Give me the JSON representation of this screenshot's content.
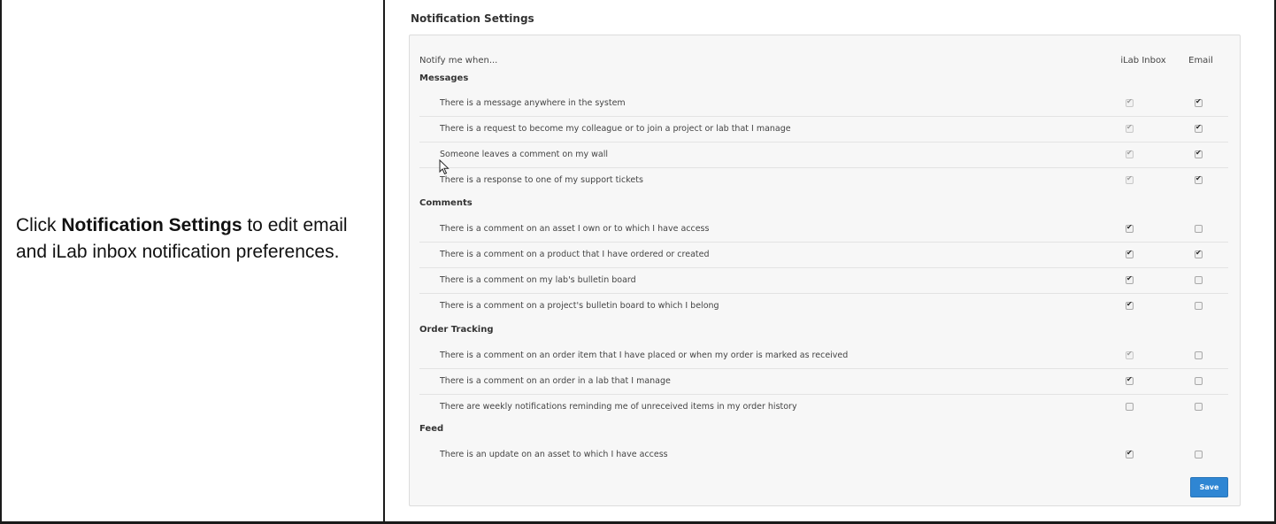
{
  "instruction": {
    "prefix": "Click ",
    "bold": "Notification Settings",
    "suffix": " to edit email and iLab inbox notification preferences."
  },
  "settings_title": "Notification Settings",
  "headers": {
    "notify": "Notify me when...",
    "inbox": "iLab Inbox",
    "email": "Email"
  },
  "sections": [
    {
      "title": "Messages",
      "rows": [
        {
          "label": "There is a message anywhere in the system",
          "inbox": true,
          "inbox_disabled": true,
          "email": true
        },
        {
          "label": "There is a request to become my colleague or to join a project or lab that I manage",
          "inbox": true,
          "inbox_disabled": true,
          "email": true
        },
        {
          "label": "Someone leaves a comment on my wall",
          "inbox": true,
          "inbox_disabled": true,
          "email": true
        },
        {
          "label": "There is a response to one of my support tickets",
          "inbox": true,
          "inbox_disabled": true,
          "email": true
        }
      ]
    },
    {
      "title": "Comments",
      "rows": [
        {
          "label": "There is a comment on an asset I own or to which I have access",
          "inbox": true,
          "inbox_disabled": false,
          "email": false
        },
        {
          "label": "There is a comment on a product that I have ordered or created",
          "inbox": true,
          "inbox_disabled": false,
          "email": true
        },
        {
          "label": "There is a comment on my lab's bulletin board",
          "inbox": true,
          "inbox_disabled": false,
          "email": false
        },
        {
          "label": "There is a comment on a project's bulletin board to which I belong",
          "inbox": true,
          "inbox_disabled": false,
          "email": false
        }
      ]
    },
    {
      "title": "Order Tracking",
      "rows": [
        {
          "label": "There is a comment on an order item that I have placed or when my order is marked as received",
          "inbox": true,
          "inbox_disabled": true,
          "email": false
        },
        {
          "label": "There is a comment on an order in a lab that I manage",
          "inbox": true,
          "inbox_disabled": false,
          "email": false
        },
        {
          "label": "There are weekly notifications reminding me of unreceived items in my order history",
          "inbox": false,
          "inbox_disabled": false,
          "email": false
        }
      ]
    },
    {
      "title": "Feed",
      "rows": [
        {
          "label": "There is an update on an asset to which I have access",
          "inbox": true,
          "inbox_disabled": false,
          "email": false
        }
      ]
    }
  ],
  "save_label": "Save",
  "colors": {
    "save_button": "#2f86d3",
    "panel_bg": "#f7f7f7",
    "frame": "#1a1a1a"
  },
  "icons": {
    "cursor": "mouse-pointer-icon",
    "check": "checkmark-icon"
  }
}
